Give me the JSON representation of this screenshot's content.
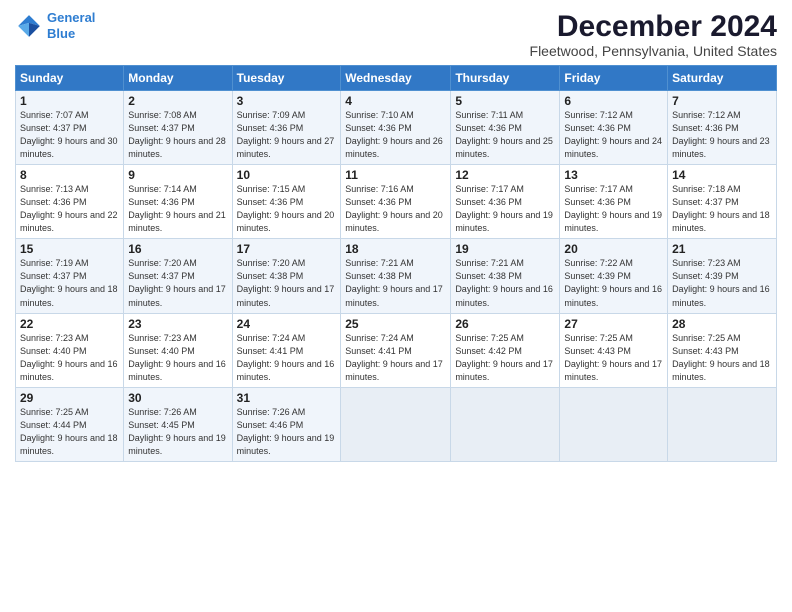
{
  "logo": {
    "line1": "General",
    "line2": "Blue"
  },
  "title": "December 2024",
  "subtitle": "Fleetwood, Pennsylvania, United States",
  "headers": [
    "Sunday",
    "Monday",
    "Tuesday",
    "Wednesday",
    "Thursday",
    "Friday",
    "Saturday"
  ],
  "weeks": [
    [
      {
        "day": "1",
        "sunrise": "Sunrise: 7:07 AM",
        "sunset": "Sunset: 4:37 PM",
        "daylight": "Daylight: 9 hours and 30 minutes."
      },
      {
        "day": "2",
        "sunrise": "Sunrise: 7:08 AM",
        "sunset": "Sunset: 4:37 PM",
        "daylight": "Daylight: 9 hours and 28 minutes."
      },
      {
        "day": "3",
        "sunrise": "Sunrise: 7:09 AM",
        "sunset": "Sunset: 4:36 PM",
        "daylight": "Daylight: 9 hours and 27 minutes."
      },
      {
        "day": "4",
        "sunrise": "Sunrise: 7:10 AM",
        "sunset": "Sunset: 4:36 PM",
        "daylight": "Daylight: 9 hours and 26 minutes."
      },
      {
        "day": "5",
        "sunrise": "Sunrise: 7:11 AM",
        "sunset": "Sunset: 4:36 PM",
        "daylight": "Daylight: 9 hours and 25 minutes."
      },
      {
        "day": "6",
        "sunrise": "Sunrise: 7:12 AM",
        "sunset": "Sunset: 4:36 PM",
        "daylight": "Daylight: 9 hours and 24 minutes."
      },
      {
        "day": "7",
        "sunrise": "Sunrise: 7:12 AM",
        "sunset": "Sunset: 4:36 PM",
        "daylight": "Daylight: 9 hours and 23 minutes."
      }
    ],
    [
      {
        "day": "8",
        "sunrise": "Sunrise: 7:13 AM",
        "sunset": "Sunset: 4:36 PM",
        "daylight": "Daylight: 9 hours and 22 minutes."
      },
      {
        "day": "9",
        "sunrise": "Sunrise: 7:14 AM",
        "sunset": "Sunset: 4:36 PM",
        "daylight": "Daylight: 9 hours and 21 minutes."
      },
      {
        "day": "10",
        "sunrise": "Sunrise: 7:15 AM",
        "sunset": "Sunset: 4:36 PM",
        "daylight": "Daylight: 9 hours and 20 minutes."
      },
      {
        "day": "11",
        "sunrise": "Sunrise: 7:16 AM",
        "sunset": "Sunset: 4:36 PM",
        "daylight": "Daylight: 9 hours and 20 minutes."
      },
      {
        "day": "12",
        "sunrise": "Sunrise: 7:17 AM",
        "sunset": "Sunset: 4:36 PM",
        "daylight": "Daylight: 9 hours and 19 minutes."
      },
      {
        "day": "13",
        "sunrise": "Sunrise: 7:17 AM",
        "sunset": "Sunset: 4:36 PM",
        "daylight": "Daylight: 9 hours and 19 minutes."
      },
      {
        "day": "14",
        "sunrise": "Sunrise: 7:18 AM",
        "sunset": "Sunset: 4:37 PM",
        "daylight": "Daylight: 9 hours and 18 minutes."
      }
    ],
    [
      {
        "day": "15",
        "sunrise": "Sunrise: 7:19 AM",
        "sunset": "Sunset: 4:37 PM",
        "daylight": "Daylight: 9 hours and 18 minutes."
      },
      {
        "day": "16",
        "sunrise": "Sunrise: 7:20 AM",
        "sunset": "Sunset: 4:37 PM",
        "daylight": "Daylight: 9 hours and 17 minutes."
      },
      {
        "day": "17",
        "sunrise": "Sunrise: 7:20 AM",
        "sunset": "Sunset: 4:38 PM",
        "daylight": "Daylight: 9 hours and 17 minutes."
      },
      {
        "day": "18",
        "sunrise": "Sunrise: 7:21 AM",
        "sunset": "Sunset: 4:38 PM",
        "daylight": "Daylight: 9 hours and 17 minutes."
      },
      {
        "day": "19",
        "sunrise": "Sunrise: 7:21 AM",
        "sunset": "Sunset: 4:38 PM",
        "daylight": "Daylight: 9 hours and 16 minutes."
      },
      {
        "day": "20",
        "sunrise": "Sunrise: 7:22 AM",
        "sunset": "Sunset: 4:39 PM",
        "daylight": "Daylight: 9 hours and 16 minutes."
      },
      {
        "day": "21",
        "sunrise": "Sunrise: 7:23 AM",
        "sunset": "Sunset: 4:39 PM",
        "daylight": "Daylight: 9 hours and 16 minutes."
      }
    ],
    [
      {
        "day": "22",
        "sunrise": "Sunrise: 7:23 AM",
        "sunset": "Sunset: 4:40 PM",
        "daylight": "Daylight: 9 hours and 16 minutes."
      },
      {
        "day": "23",
        "sunrise": "Sunrise: 7:23 AM",
        "sunset": "Sunset: 4:40 PM",
        "daylight": "Daylight: 9 hours and 16 minutes."
      },
      {
        "day": "24",
        "sunrise": "Sunrise: 7:24 AM",
        "sunset": "Sunset: 4:41 PM",
        "daylight": "Daylight: 9 hours and 16 minutes."
      },
      {
        "day": "25",
        "sunrise": "Sunrise: 7:24 AM",
        "sunset": "Sunset: 4:41 PM",
        "daylight": "Daylight: 9 hours and 17 minutes."
      },
      {
        "day": "26",
        "sunrise": "Sunrise: 7:25 AM",
        "sunset": "Sunset: 4:42 PM",
        "daylight": "Daylight: 9 hours and 17 minutes."
      },
      {
        "day": "27",
        "sunrise": "Sunrise: 7:25 AM",
        "sunset": "Sunset: 4:43 PM",
        "daylight": "Daylight: 9 hours and 17 minutes."
      },
      {
        "day": "28",
        "sunrise": "Sunrise: 7:25 AM",
        "sunset": "Sunset: 4:43 PM",
        "daylight": "Daylight: 9 hours and 18 minutes."
      }
    ],
    [
      {
        "day": "29",
        "sunrise": "Sunrise: 7:25 AM",
        "sunset": "Sunset: 4:44 PM",
        "daylight": "Daylight: 9 hours and 18 minutes."
      },
      {
        "day": "30",
        "sunrise": "Sunrise: 7:26 AM",
        "sunset": "Sunset: 4:45 PM",
        "daylight": "Daylight: 9 hours and 19 minutes."
      },
      {
        "day": "31",
        "sunrise": "Sunrise: 7:26 AM",
        "sunset": "Sunset: 4:46 PM",
        "daylight": "Daylight: 9 hours and 19 minutes."
      },
      null,
      null,
      null,
      null
    ]
  ]
}
